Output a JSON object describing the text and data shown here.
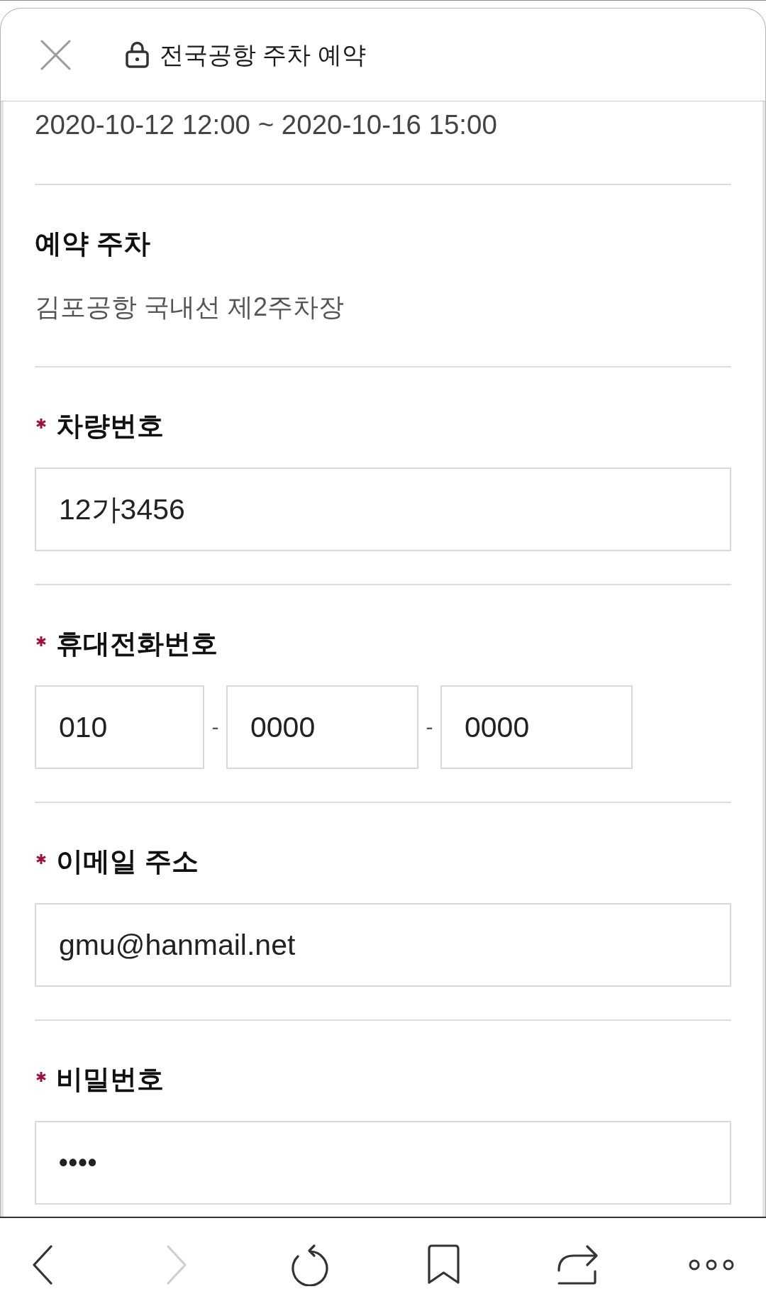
{
  "header": {
    "title": "전국공항 주차 예약",
    "secure": true
  },
  "period": "2020-10-12 12:00 ~ 2020-10-16 15:00",
  "sections": [
    {
      "kind": "info",
      "label": "예약 주차",
      "required": false,
      "value": "김포공항 국내선 제2주차장"
    },
    {
      "kind": "text",
      "label": "차량번호",
      "required": true,
      "value": "12가3456"
    },
    {
      "kind": "phone",
      "label": "휴대전화번호",
      "required": true,
      "parts": [
        {
          "value": "010"
        },
        {
          "separator": "-",
          "value": "0000"
        },
        {
          "separator": "-",
          "value": "0000"
        }
      ]
    },
    {
      "kind": "text",
      "label": "이메일 주소",
      "required": true,
      "value": "gmu@hanmail.net"
    },
    {
      "kind": "password",
      "label": "비밀번호",
      "required": true,
      "value": "••••"
    }
  ],
  "toolbar": [
    {
      "kind": "back",
      "disabled": false
    },
    {
      "kind": "forward",
      "disabled": true
    },
    {
      "kind": "refresh",
      "disabled": false
    },
    {
      "kind": "bookmark",
      "disabled": false
    },
    {
      "kind": "share",
      "disabled": false
    },
    {
      "kind": "more",
      "disabled": false
    }
  ]
}
